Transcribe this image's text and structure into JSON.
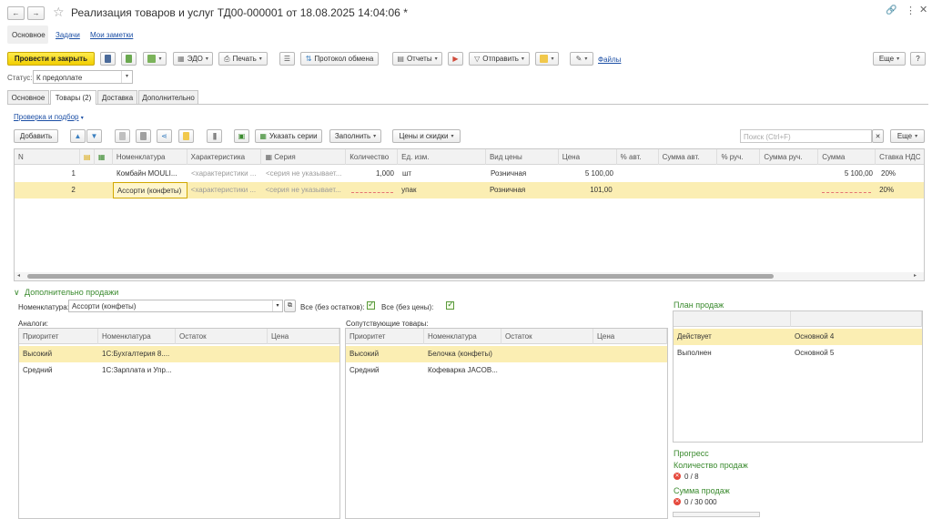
{
  "window": {
    "title": "Реализация товаров и услуг ТД00-000001 от 18.08.2025 14:04:06 *",
    "back_glyph": "←",
    "forward_glyph": "→"
  },
  "nav_tabs": [
    "Основное",
    "Задачи",
    "Мои заметки"
  ],
  "toolbar": {
    "post_close": "Провести и закрыть",
    "edo": "ЭДО",
    "print": "Печать",
    "exchange_protocol": "Протокол обмена",
    "reports": "Отчеты",
    "send": "Отправить",
    "files": "Файлы",
    "more": "Еще",
    "help": "?"
  },
  "status": {
    "label": "Статус:",
    "value": "К предоплате"
  },
  "form_tabs": [
    "Основное",
    "Товары (2)",
    "Доставка",
    "Дополнительно"
  ],
  "goods": {
    "selection_link": "Проверка и подбор",
    "add_button": "Добавить",
    "series_button": "Указать серии",
    "fill_button": "Заполнить",
    "prices_button": "Цены и скидки",
    "search_placeholder": "Поиск (Ctrl+F)",
    "more_button": "Еще",
    "columns": [
      "N",
      "",
      "",
      "Номенклатура",
      "Характеристика",
      "Серия",
      "Количество",
      "Ед. изм.",
      "Вид цены",
      "Цена",
      "% авт.",
      "Сумма авт.",
      "% руч.",
      "Сумма руч.",
      "Сумма",
      "Ставка НДС"
    ],
    "rows": [
      {
        "n": "1",
        "item": "Комбайн MOULI...",
        "char": "<характеристики ...",
        "series": "<серия не указывает...",
        "qty": "1,000",
        "unit": "шт",
        "price_kind": "Розничная",
        "price": "5 100,00",
        "sum": "5 100,00",
        "vat": "20%"
      },
      {
        "n": "2",
        "item": "Ассорти (конфеты)",
        "char": "<характеристики ...",
        "series": "<серия не указывает...",
        "qty": "",
        "unit": "упак",
        "price_kind": "Розничная",
        "price": "101,00",
        "sum": "",
        "vat": "20%"
      }
    ]
  },
  "extra_sales": {
    "title": "Дополнительно продажи",
    "nomenclature_label": "Номенклатура:",
    "nomenclature_value": "Ассорти (конфеты)",
    "all_stock_label": "Все (без остатков):",
    "all_price_label": "Все (без цены):",
    "analogs_label": "Аналоги:",
    "related_label": "Сопутствующие товары:",
    "sub_columns": [
      "Приоритет",
      "Номенклатура",
      "Остаток",
      "Цена"
    ],
    "analogs": [
      {
        "priority": "Высокий",
        "item": "1С:Бухгалтерия 8...."
      },
      {
        "priority": "Средний",
        "item": "1С:Зарплата и Упр..."
      }
    ],
    "related": [
      {
        "priority": "Высокий",
        "item": "Белочка (конфеты)"
      },
      {
        "priority": "Средний",
        "item": "Кофеварка JACOB..."
      }
    ]
  },
  "sales_plan": {
    "title": "План продаж",
    "rows": [
      {
        "state": "Действует",
        "plan": "Основной 4"
      },
      {
        "state": "Выполнен",
        "plan": "Основной 5"
      }
    ],
    "progress_title": "Прогресс",
    "qty_title": "Количество продаж",
    "qty_value": "0 / 8",
    "sum_title": "Сумма продаж",
    "sum_value": "0 / 30 000"
  },
  "colors": {
    "accent_yellow": "#f5d000",
    "selection": "#fbeeb3",
    "green": "#3a8a2e",
    "link": "#1c4fa5"
  }
}
